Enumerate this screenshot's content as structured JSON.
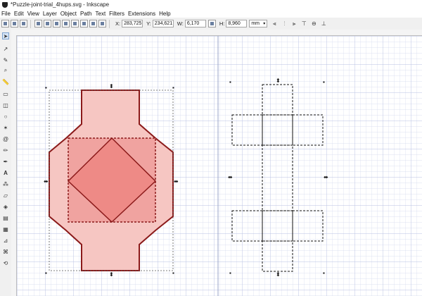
{
  "window": {
    "title": "*Puzzle-joint-trial_4hups.svg - Inkscape"
  },
  "menu": [
    "File",
    "Edit",
    "View",
    "Layer",
    "Object",
    "Path",
    "Text",
    "Filters",
    "Extensions",
    "Help"
  ],
  "toolbar": {
    "x_label": "X:",
    "x_value": "283,725",
    "y_label": "Y:",
    "y_value": "234,621",
    "w_label": "W:",
    "w_value": "6,170",
    "h_label": "H:",
    "h_value": "8,960",
    "unit": "mm",
    "align_icons": [
      "align-left-icon",
      "align-center-icon",
      "align-right-icon",
      "align-top-icon",
      "align-middle-icon",
      "align-bottom-icon"
    ]
  },
  "tools": [
    "selector-icon",
    "node-icon",
    "tweak-icon",
    "zoom-icon",
    "measure-icon",
    "rectangle-icon",
    "box3d-icon",
    "ellipse-icon",
    "star-icon",
    "spiral-icon",
    "pencil-icon",
    "pen-icon",
    "calligraphy-icon",
    "text-icon",
    "spray-icon",
    "eraser-icon",
    "paint-bucket-icon",
    "gradient-icon",
    "mesh-icon",
    "dropper-icon",
    "connector-icon"
  ],
  "colors": {
    "grid_minor": "#d3d8ee",
    "grid_major": "#b9c1e3",
    "shape_stroke": "#8b1a1a",
    "shape_fill_light": "#f6c6c2",
    "shape_fill_mid": "#f0a3a0",
    "shape_fill_dark": "#ee8a86",
    "selection_dash": "#555555"
  }
}
